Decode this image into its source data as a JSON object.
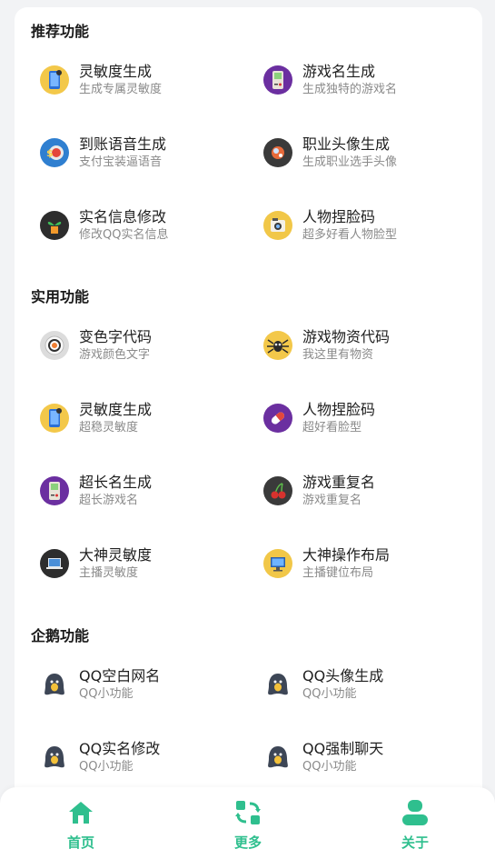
{
  "sections": [
    {
      "title": "推荐功能",
      "items": [
        {
          "title": "灵敏度生成",
          "subtitle": "生成专属灵敏度",
          "icon": "phone-icon"
        },
        {
          "title": "游戏名生成",
          "subtitle": "生成独特的游戏名",
          "icon": "gameboy-icon"
        },
        {
          "title": "到账语音生成",
          "subtitle": "支付宝装逼语音",
          "icon": "coin-icon"
        },
        {
          "title": "职业头像生成",
          "subtitle": "生成职业选手头像",
          "icon": "avatar-icon"
        },
        {
          "title": "实名信息修改",
          "subtitle": "修改QQ实名信息",
          "icon": "plant-icon"
        },
        {
          "title": "人物捏脸码",
          "subtitle": "超多好看人物脸型",
          "icon": "camera-icon"
        }
      ]
    },
    {
      "title": "实用功能",
      "items": [
        {
          "title": "变色字代码",
          "subtitle": "游戏颜色文字",
          "icon": "sushi-icon"
        },
        {
          "title": "游戏物资代码",
          "subtitle": "我这里有物资",
          "icon": "spider-icon"
        },
        {
          "title": "灵敏度生成",
          "subtitle": "超稳灵敏度",
          "icon": "phone-icon"
        },
        {
          "title": "人物捏脸码",
          "subtitle": "超好看脸型",
          "icon": "pill-icon"
        },
        {
          "title": "超长名生成",
          "subtitle": "超长游戏名",
          "icon": "gameboy-icon"
        },
        {
          "title": "游戏重复名",
          "subtitle": "游戏重复名",
          "icon": "cherry-icon"
        },
        {
          "title": "大神灵敏度",
          "subtitle": "主播灵敏度",
          "icon": "laptop-icon"
        },
        {
          "title": "大神操作布局",
          "subtitle": "主播键位布局",
          "icon": "monitor-icon"
        }
      ]
    },
    {
      "title": "企鹅功能",
      "items": [
        {
          "title": "QQ空白网名",
          "subtitle": "QQ小功能",
          "icon": "penguin-icon"
        },
        {
          "title": "QQ头像生成",
          "subtitle": "QQ小功能",
          "icon": "penguin-icon"
        },
        {
          "title": "QQ实名修改",
          "subtitle": "QQ小功能",
          "icon": "penguin-icon"
        },
        {
          "title": "QQ强制聊天",
          "subtitle": "QQ小功能",
          "icon": "penguin-icon"
        }
      ]
    }
  ],
  "tabbar": {
    "home": "首页",
    "more": "更多",
    "about": "关于"
  },
  "colors": {
    "accent": "#2fbf8e",
    "background": "#f2f3f5",
    "card": "#ffffff"
  }
}
